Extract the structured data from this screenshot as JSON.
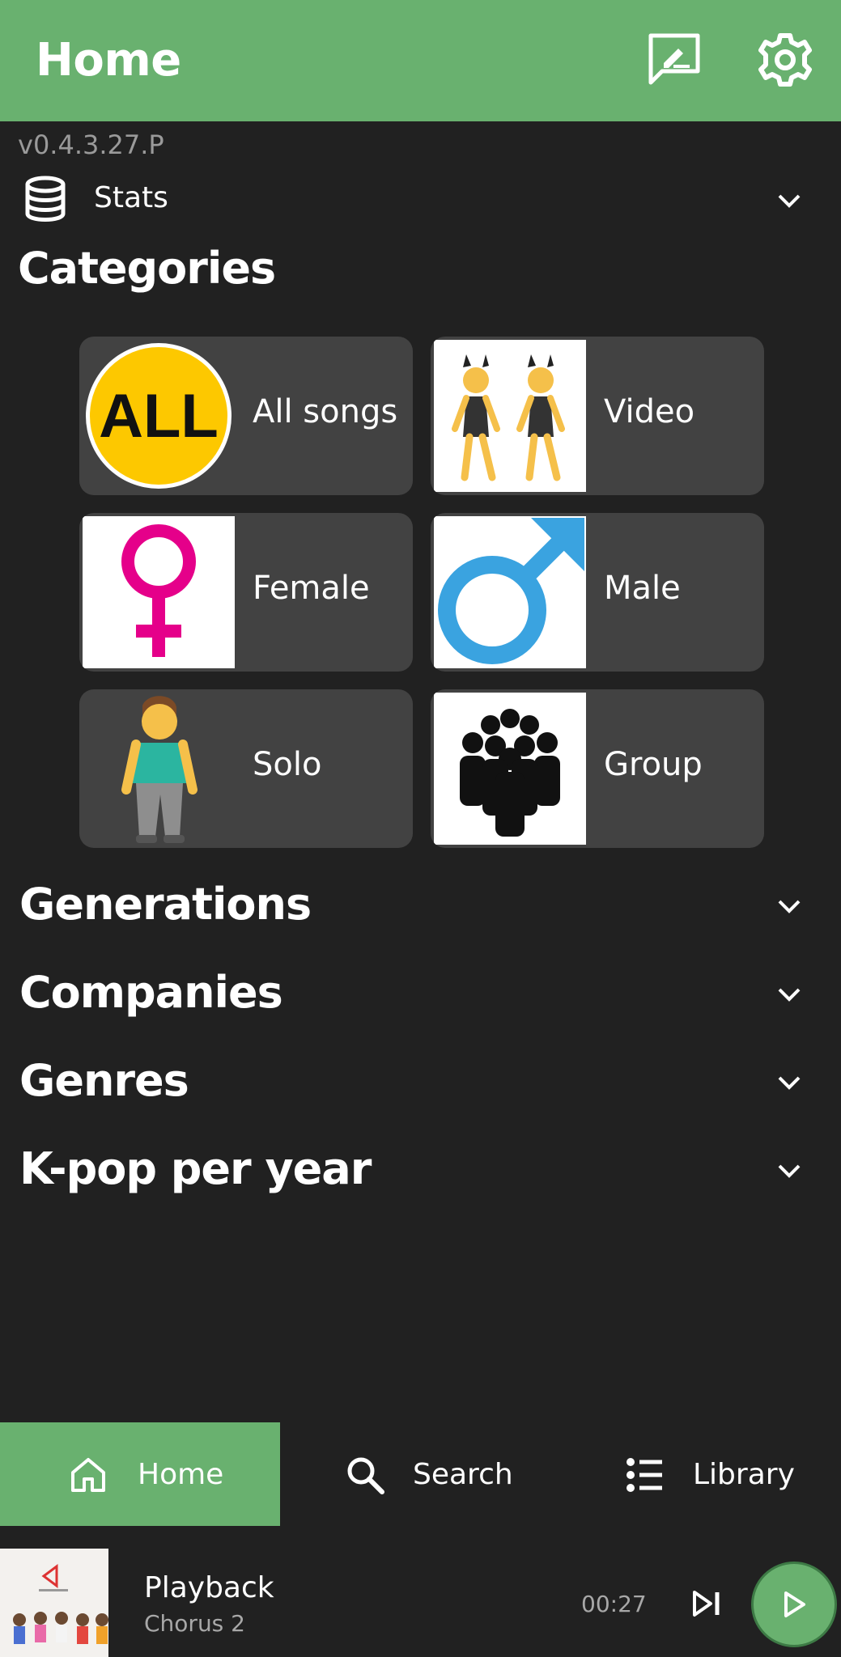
{
  "appbar": {
    "title": "Home",
    "feedback_icon": "message-edit-icon",
    "settings_icon": "gear-icon"
  },
  "version": "v0.4.3.27.P",
  "stats": {
    "label": "Stats",
    "icon": "database-icon"
  },
  "categories": {
    "title": "Categories",
    "items": [
      {
        "label": "All songs",
        "thumb": "ALL"
      },
      {
        "label": "Video"
      },
      {
        "label": "Female"
      },
      {
        "label": "Male"
      },
      {
        "label": "Solo"
      },
      {
        "label": "Group"
      }
    ]
  },
  "sections": [
    {
      "label": "Generations"
    },
    {
      "label": "Companies"
    },
    {
      "label": "Genres"
    },
    {
      "label": "K-pop per year"
    }
  ],
  "bottom_nav": [
    {
      "label": "Home",
      "icon": "home-icon",
      "active": true
    },
    {
      "label": "Search",
      "icon": "search-icon",
      "active": false
    },
    {
      "label": "Library",
      "icon": "list-icon",
      "active": false
    }
  ],
  "player": {
    "title": "Playback",
    "subtitle": "Chorus 2",
    "time": "00:27"
  },
  "colors": {
    "accent": "#69b16f",
    "background": "#212121",
    "card": "#424242"
  }
}
